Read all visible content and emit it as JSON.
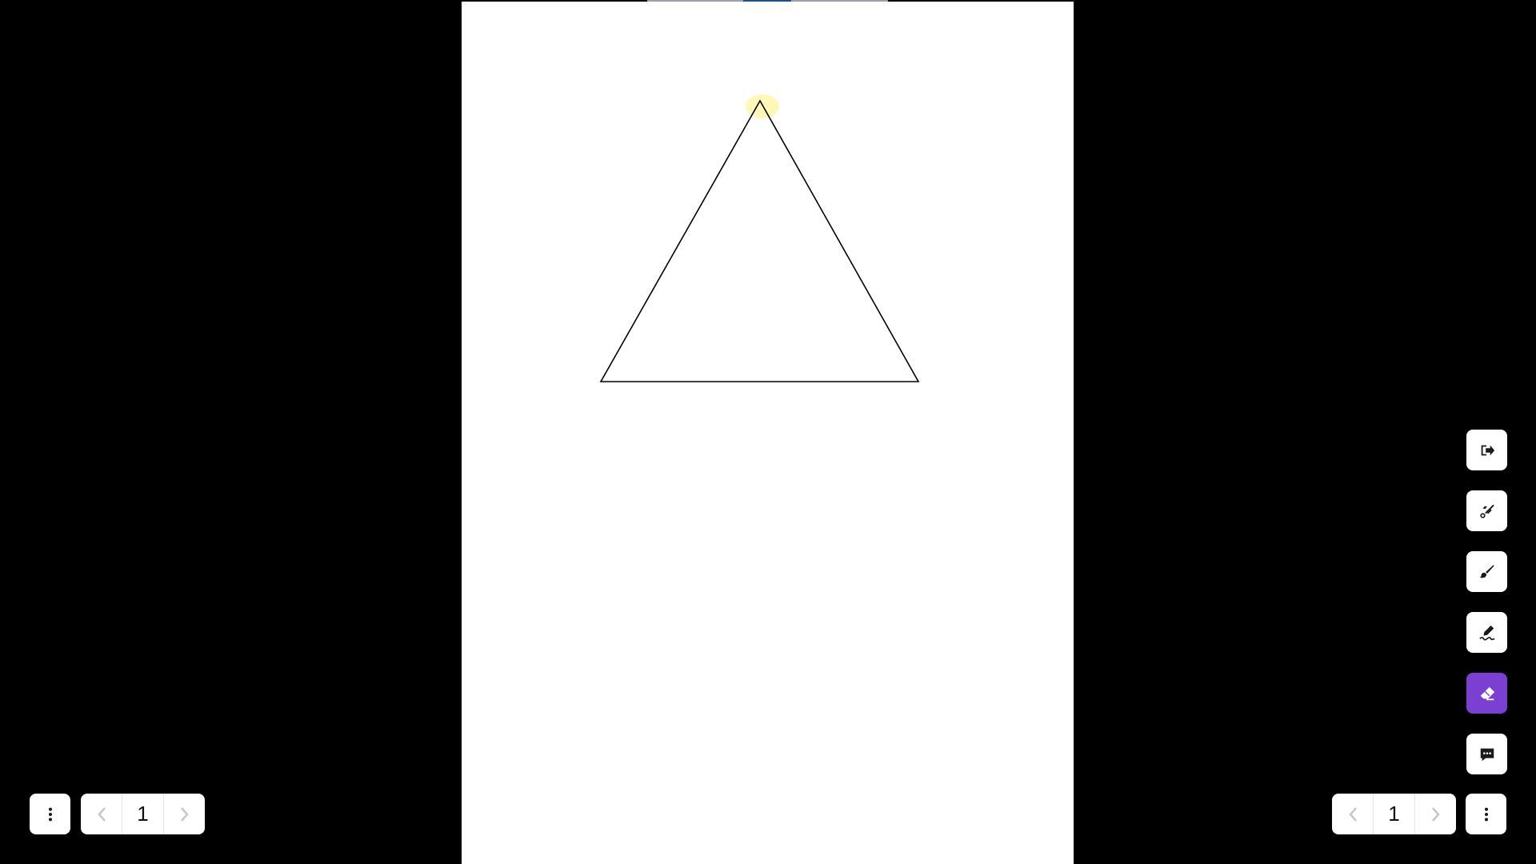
{
  "canvas": {
    "background": "#000000",
    "page_background": "#ffffff",
    "highlight_color": "#fff59d",
    "stroke_color": "#000000"
  },
  "left_controls": {
    "menu_icon": "vertical-dots-icon",
    "prev_icon": "chevron-left-icon",
    "next_icon": "chevron-right-icon",
    "page_number": "1"
  },
  "right_controls": {
    "prev_icon": "chevron-left-icon",
    "next_icon": "chevron-right-icon",
    "page_number": "1",
    "menu_icon": "vertical-dots-icon"
  },
  "toolbar": {
    "accent_color": "#7b3fd1",
    "tools": [
      {
        "icon": "exit-icon",
        "active": false
      },
      {
        "icon": "laser-pointer-icon",
        "active": false
      },
      {
        "icon": "brush-icon",
        "active": false
      },
      {
        "icon": "signature-pen-icon",
        "active": false
      },
      {
        "icon": "eraser-icon",
        "active": true
      },
      {
        "icon": "comment-icon",
        "active": false
      }
    ]
  }
}
